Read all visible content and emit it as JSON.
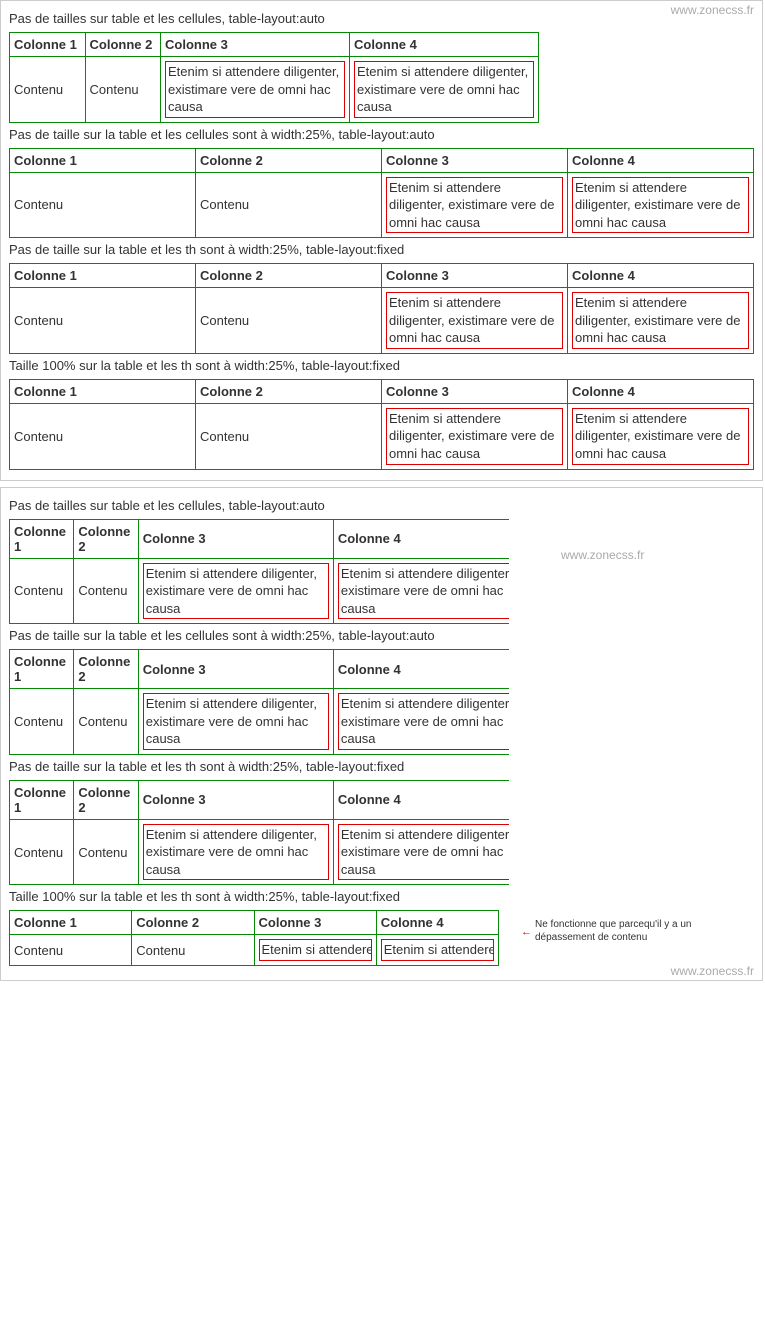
{
  "watermark": "www.zonecss.fr",
  "captions": {
    "c1": "Pas de tailles sur table et les cellules, table-layout:auto",
    "c2": "Pas de taille sur la table et les cellules sont à width:25%, table-layout:auto",
    "c3": "Pas de taille sur la table et les th sont à width:25%, table-layout:fixed",
    "c4": "Taille 100% sur la table et les th sont à width:25%, table-layout:fixed"
  },
  "headers": {
    "h1": "Colonne 1",
    "h2": "Colonne 2",
    "h3": "Colonne 3",
    "h4": "Colonne 4"
  },
  "cells": {
    "short": "Contenu",
    "long": "Etenim si attendere diligenter, existimare vere de omni hac causa"
  },
  "annotation": {
    "arrow": "←",
    "text": "Ne fonctionne que parcequ'il y a un dépassement de contenu"
  }
}
